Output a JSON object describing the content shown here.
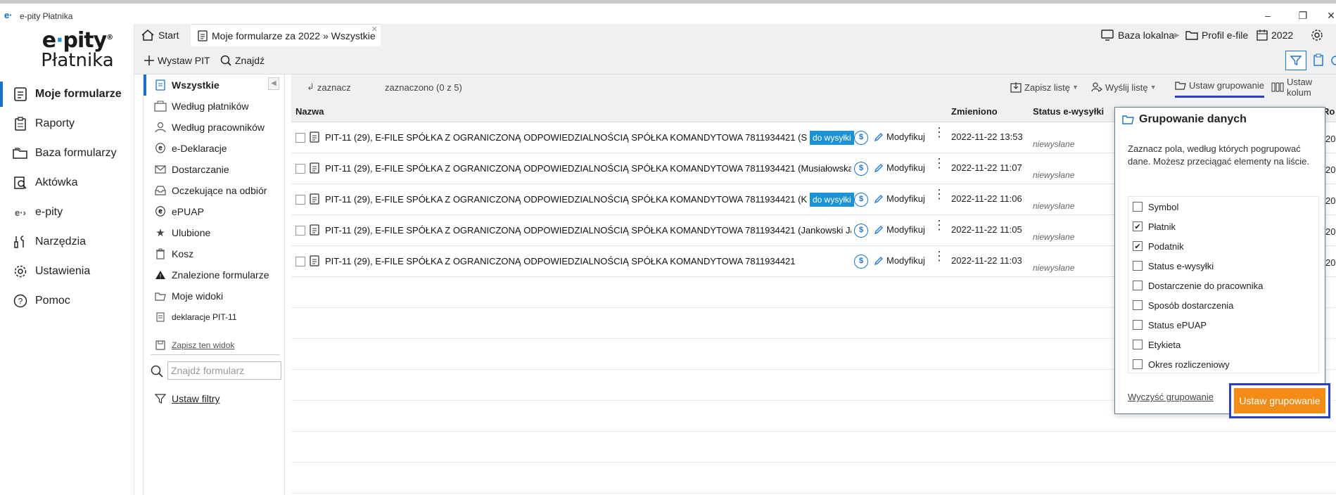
{
  "window": {
    "logo_small": "e·",
    "title": "e-pity Płatnika",
    "controls": [
      "–",
      "❐",
      "✕"
    ]
  },
  "brand": {
    "line1_a": "e",
    "line1_dot": "·",
    "line1_b": "pity",
    "reg": "®",
    "line2": "Płatnika"
  },
  "nav": [
    {
      "label": "Moje formularze",
      "icon": "forms-icon",
      "active": true
    },
    {
      "label": "Raporty",
      "icon": "clipboard-icon"
    },
    {
      "label": "Baza formularzy",
      "icon": "folders-icon"
    },
    {
      "label": "Aktówka",
      "icon": "briefcase-search-icon"
    },
    {
      "label": "e-pity",
      "icon": "epity-logo-icon"
    },
    {
      "label": "Narzędzia",
      "icon": "tools-icon"
    },
    {
      "label": "Ustawienia",
      "icon": "gear-icon"
    },
    {
      "label": "Pomoc",
      "icon": "help-icon"
    }
  ],
  "tabs": {
    "start": "Start",
    "current": "Moje formularze za 2022 » Wszystkie",
    "close": "✕"
  },
  "topright": {
    "db": "Baza lokalna",
    "profile": "Profil e-file",
    "year": "2022"
  },
  "toolbar": {
    "issue": "Wystaw PIT",
    "find": "Znajdź"
  },
  "sidebar2": {
    "items": [
      {
        "label": "Wszystkie",
        "icon": "form-icon",
        "active": true
      },
      {
        "label": "Według płatników",
        "icon": "building-icon"
      },
      {
        "label": "Według pracowników",
        "icon": "person-icon"
      },
      {
        "label": "e-Deklaracje",
        "icon": "edeklaracje-icon"
      },
      {
        "label": "Dostarczanie",
        "icon": "envelope-icon"
      },
      {
        "label": "Oczekujące na odbiór",
        "icon": "inbox-icon"
      },
      {
        "label": "ePUAP",
        "icon": "epuap-icon"
      },
      {
        "label": "Ulubione",
        "icon": "star-icon"
      },
      {
        "label": "Kosz",
        "icon": "trash-icon"
      },
      {
        "label": "Znalezione formularze",
        "icon": "warning-icon"
      },
      {
        "label": "Moje widoki",
        "icon": "folder-icon"
      },
      {
        "label": "deklaracje PIT-11",
        "icon": "form-icon"
      }
    ],
    "save_view": "Zapisz ten widok",
    "search_placeholder": "Znajdź formularz",
    "set_filters": "Ustaw filtry"
  },
  "subbar": {
    "select": "zaznacz",
    "selected": "zaznaczono (0 z 5)",
    "save_list": "Zapisz listę",
    "send_list": "Wyślij listę",
    "set_grouping": "Ustaw grupowanie",
    "set_columns": "Ustaw kolum"
  },
  "table": {
    "headers": {
      "name": "Nazwa",
      "changed": "Zmieniono",
      "status": "Status e-wysyłki",
      "col_r": "Ro"
    },
    "modify_label": "Modyfikuj",
    "rows": [
      {
        "name": "PIT-11 (29), E-FILE SPÓŁKA Z OGRANICZONĄ ODPOWIEDZIALNOŚCIĄ SPÓŁKA KOMANDYTOWA 7811934421 (S",
        "badge": "do wysyłki",
        "date": "2022-11-22 13:53",
        "status": "niewysłane",
        "r": "20"
      },
      {
        "name": "PIT-11 (29), E-FILE SPÓŁKA Z OGRANICZONĄ ODPOWIEDZIALNOŚCIĄ SPÓŁKA KOMANDYTOWA 7811934421 (Musiałowska",
        "badge": "",
        "date": "2022-11-22 11:07",
        "status": "niewysłane",
        "r": "20"
      },
      {
        "name": "PIT-11 (29), E-FILE SPÓŁKA Z OGRANICZONĄ ODPOWIEDZIALNOŚCIĄ SPÓŁKA KOMANDYTOWA 7811934421 (K",
        "badge": "do wysyłki",
        "date": "2022-11-22 11:06",
        "status": "niewysłane",
        "r": "20"
      },
      {
        "name": "PIT-11 (29), E-FILE SPÓŁKA Z OGRANICZONĄ ODPOWIEDZIALNOŚCIĄ SPÓŁKA KOMANDYTOWA 7811934421 (Jankowski Ja",
        "badge": "",
        "date": "2022-11-22 11:05",
        "status": "niewysłane",
        "r": "20"
      },
      {
        "name": "PIT-11 (29), E-FILE SPÓŁKA Z OGRANICZONĄ ODPOWIEDZIALNOŚCIĄ SPÓŁKA KOMANDYTOWA 7811934421",
        "badge": "",
        "date": "2022-11-22 11:03",
        "status": "niewysłane",
        "r": "20"
      }
    ]
  },
  "popup": {
    "title": "Grupowanie danych",
    "description": "Zaznacz pola, według których pogrupować dane. Możesz przeciągać elementy na liście.",
    "fields": [
      {
        "label": "Symbol",
        "checked": false
      },
      {
        "label": "Płatnik",
        "checked": true
      },
      {
        "label": "Podatnik",
        "checked": true
      },
      {
        "label": "Status e-wysyłki",
        "checked": false
      },
      {
        "label": "Dostarczenie do pracownika",
        "checked": false
      },
      {
        "label": "Sposób dostarczenia",
        "checked": false
      },
      {
        "label": "Status ePUAP",
        "checked": false
      },
      {
        "label": "Etykieta",
        "checked": false
      },
      {
        "label": "Okres rozliczeniowy",
        "checked": false
      }
    ],
    "clear": "Wyczyść grupowanie",
    "apply": "Ustaw grupowanie"
  },
  "colors": {
    "accent_blue": "#1a73c9",
    "badge_blue": "#1a93d6",
    "highlight_border": "#2a40c8",
    "apply_orange": "#f28c17",
    "chrome_gray": "#eef0f2"
  }
}
